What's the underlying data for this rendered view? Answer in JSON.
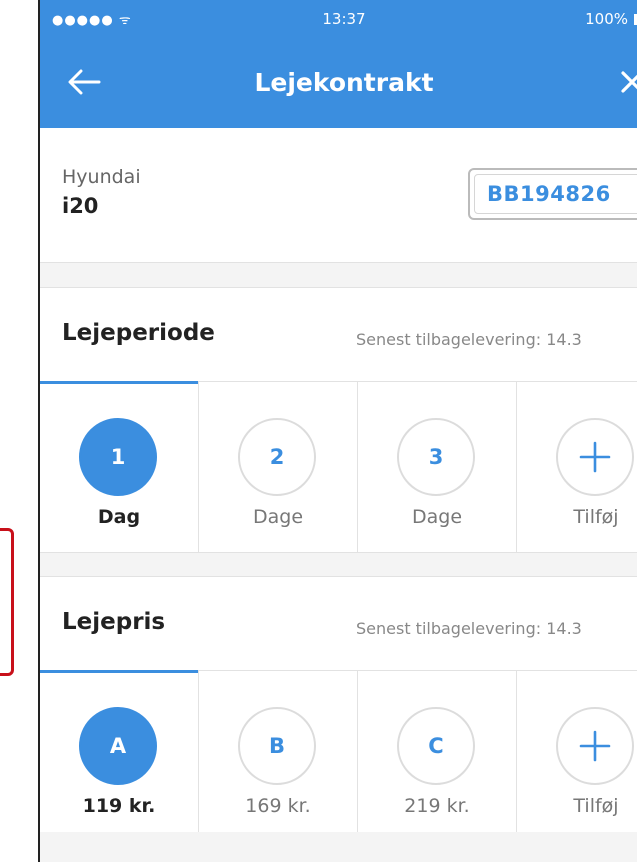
{
  "status_bar": {
    "signal": "●●●●● ᯤ",
    "time": "13:37",
    "battery": "100%"
  },
  "nav": {
    "title": "Lejekontrakt",
    "back_icon": "arrow-left-icon",
    "close_icon": "close-icon"
  },
  "car": {
    "brand": "Hyundai",
    "model": "i20",
    "plate": "BB194826"
  },
  "rental_period": {
    "title": "Lejeperiode",
    "subtitle": "Senest tilbagelevering: 14.3",
    "options": [
      {
        "number": "1",
        "label": "Dag"
      },
      {
        "number": "2",
        "label": "Dage"
      },
      {
        "number": "3",
        "label": "Dage"
      },
      {
        "number": "+",
        "label": "Tilføj"
      }
    ]
  },
  "rental_price": {
    "title": "Lejepris",
    "subtitle": "Senest tilbagelevering: 14.3",
    "options": [
      {
        "number": "A",
        "label": "119 kr."
      },
      {
        "number": "B",
        "label": "169 kr."
      },
      {
        "number": "C",
        "label": "219 kr."
      },
      {
        "number": "+",
        "label": "Tilføj"
      }
    ]
  },
  "colors": {
    "accent": "#3b8edf",
    "marker": "#c8101a"
  }
}
